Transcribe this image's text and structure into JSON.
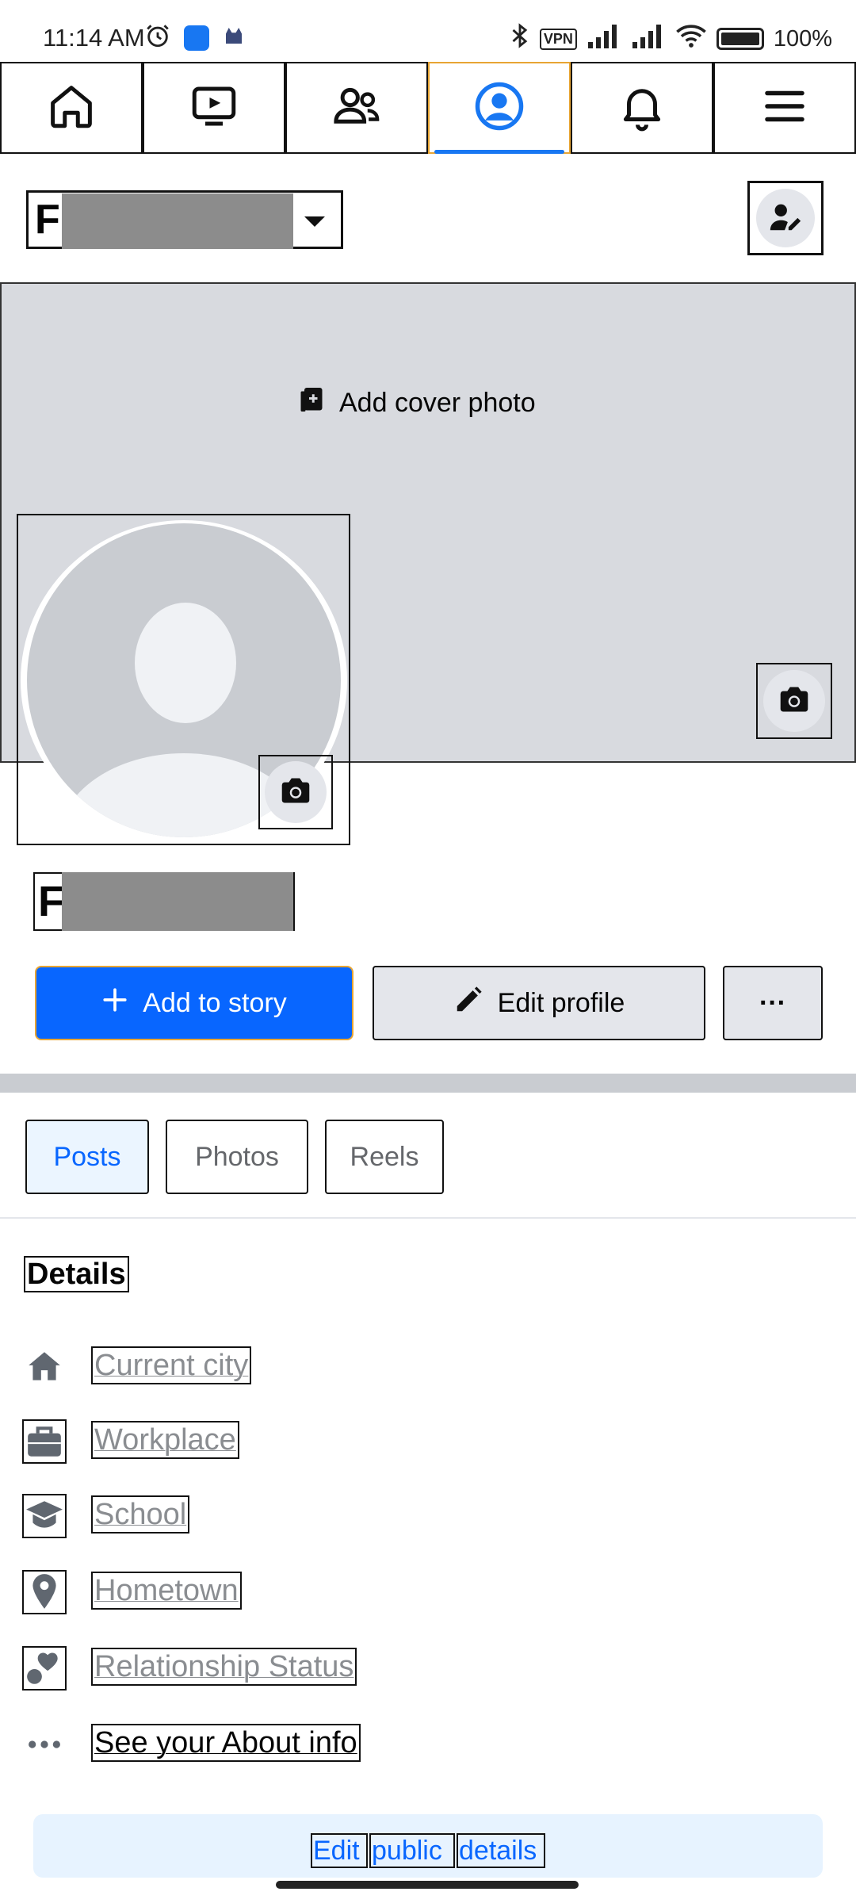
{
  "status_bar": {
    "time": "11:14 AM",
    "battery": "100%",
    "icons": [
      "alarm-icon",
      "app-icon",
      "bot-icon",
      "bluetooth-icon",
      "vpn-icon",
      "signal-icon",
      "signal-icon",
      "wifi-icon",
      "battery-icon"
    ],
    "vpn_label": "VPN"
  },
  "nav": {
    "tabs": [
      {
        "name": "home",
        "icon": "home-icon",
        "active": false
      },
      {
        "name": "video",
        "icon": "video-icon",
        "active": false
      },
      {
        "name": "friends",
        "icon": "friends-icon",
        "active": false
      },
      {
        "name": "profile",
        "icon": "profile-icon",
        "active": true
      },
      {
        "name": "notifications",
        "icon": "bell-icon",
        "active": false
      },
      {
        "name": "menu",
        "icon": "menu-icon",
        "active": false
      }
    ]
  },
  "header": {
    "name_initial": "F"
  },
  "cover": {
    "add_cover_label": "Add cover photo"
  },
  "profile": {
    "name_initial": "F"
  },
  "actions": {
    "add_story": "Add to story",
    "edit_profile": "Edit profile",
    "more": "···"
  },
  "tabs": [
    {
      "label": "Posts",
      "active": true
    },
    {
      "label": "Photos",
      "active": false
    },
    {
      "label": "Reels",
      "active": false
    }
  ],
  "details": {
    "title": "Details",
    "items": [
      {
        "label": "Current city",
        "icon": "home-filled-icon"
      },
      {
        "label": "Workplace",
        "icon": "briefcase-icon"
      },
      {
        "label": "School",
        "icon": "graduation-cap-icon"
      },
      {
        "label": "Hometown",
        "icon": "location-pin-icon"
      },
      {
        "label": "Relationship Status",
        "icon": "hearts-icon"
      },
      {
        "label": "See your About info",
        "icon": "more-dots-icon"
      }
    ]
  },
  "public_details": {
    "edit": "Edit",
    "public": "public",
    "details": "details"
  },
  "colors": {
    "accent": "#0866ff",
    "cover_bg": "#d8dadf",
    "muted_text": "#8a8d91"
  }
}
